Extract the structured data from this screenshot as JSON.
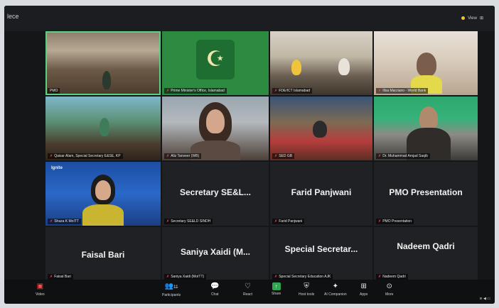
{
  "app": {
    "title": "lece",
    "view_label": "View"
  },
  "tiles": [
    {
      "id": "pmo",
      "label": "PMO"
    },
    {
      "id": "pm-office",
      "label": "Prime Minister's Office, Islamabad"
    },
    {
      "id": "fde",
      "label": "FDE/ICT Islamabad"
    },
    {
      "id": "world-bank",
      "label": "Illsa Marziano - World Bank"
    },
    {
      "id": "qaisar",
      "label": "Qaisar Alam, Special Secretary E&SE, KP"
    },
    {
      "id": "aliz",
      "label": "Aliz Tanveer (WB)"
    },
    {
      "id": "sed",
      "label": "SED GB"
    },
    {
      "id": "asghar",
      "label": "Dr. Muhammad Amjad Saqib"
    },
    {
      "id": "shaza",
      "label": "Shaza K MoITT"
    },
    {
      "id": "secretary-sel",
      "label": "Secretary SE&LD SINDH",
      "big": "Secretary SE&L..."
    },
    {
      "id": "farid",
      "label": "Farid Panjwani",
      "big": "Farid Panjwani"
    },
    {
      "id": "pmo-presentation",
      "label": "PMO Presentation",
      "big": "PMO Presentation"
    },
    {
      "id": "faisal",
      "label": "Faisal Bari",
      "big": "Faisal Bari"
    },
    {
      "id": "saniya",
      "label": "Saniya Xaidi (MoITT)",
      "big": "Saniya Xaidi (M..."
    },
    {
      "id": "special-secretary",
      "label": "Special Secretary Education AJK",
      "big": "Special Secretar..."
    },
    {
      "id": "nadeem",
      "label": "Nadeem Qadri",
      "big": "Nadeem Qadri"
    }
  ],
  "shaza_logo": "Ignite",
  "toolbar": {
    "video": "Video",
    "participants": "Participants",
    "participants_count": "11",
    "chat": "Chat",
    "react": "React",
    "share": "Share",
    "host_tools": "Host tools",
    "ai_companion": "AI Companion",
    "apps": "Apps",
    "more": "More"
  },
  "colors": {
    "accent_green": "#2fa84f",
    "mic_red": "#ff4a4a",
    "active_border": "#58d27e"
  }
}
